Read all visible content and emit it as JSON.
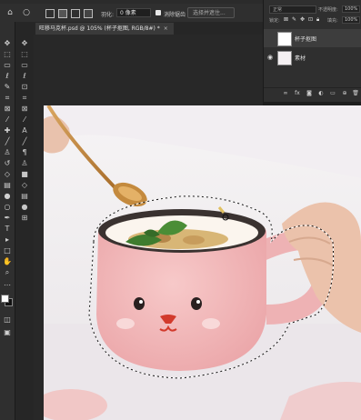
{
  "options_bar": {
    "feather_label": "羽化:",
    "feather_value": "0 像素",
    "antialias_label": "消除锯齿",
    "select_mask_label": "选择并遮住..."
  },
  "document_tab": {
    "title": "旺移马克杯.psd @ 105% (杯子抠图, RGB/8#) *",
    "close": "×"
  },
  "layers_panel": {
    "blend_mode": "正常",
    "opacity_label": "不透明度:",
    "opacity_value": "100%",
    "lock_label": "锁定:",
    "fill_label": "填充:",
    "fill_value": "100%",
    "layers": [
      {
        "name": "杯子抠图",
        "visible": false,
        "selected": true
      },
      {
        "name": "素材",
        "visible": true,
        "selected": false
      }
    ],
    "footer_icons": [
      "link-icon",
      "fx-icon",
      "mask-icon",
      "adjustment-icon",
      "group-icon",
      "new-layer-icon",
      "trash-icon"
    ]
  },
  "tools": [
    "move-icon",
    "artboard-icon",
    "marquee-icon",
    "lasso-icon",
    "quick-select-icon",
    "crop-icon",
    "frame-icon",
    "eyedropper-icon",
    "healing-icon",
    "brush-icon",
    "stamp-icon",
    "history-brush-icon",
    "eraser-icon",
    "gradient-icon",
    "blur-icon",
    "dodge-icon",
    "pen-icon",
    "type-icon",
    "path-select-icon",
    "shape-icon",
    "hand-icon",
    "zoom-icon"
  ]
}
